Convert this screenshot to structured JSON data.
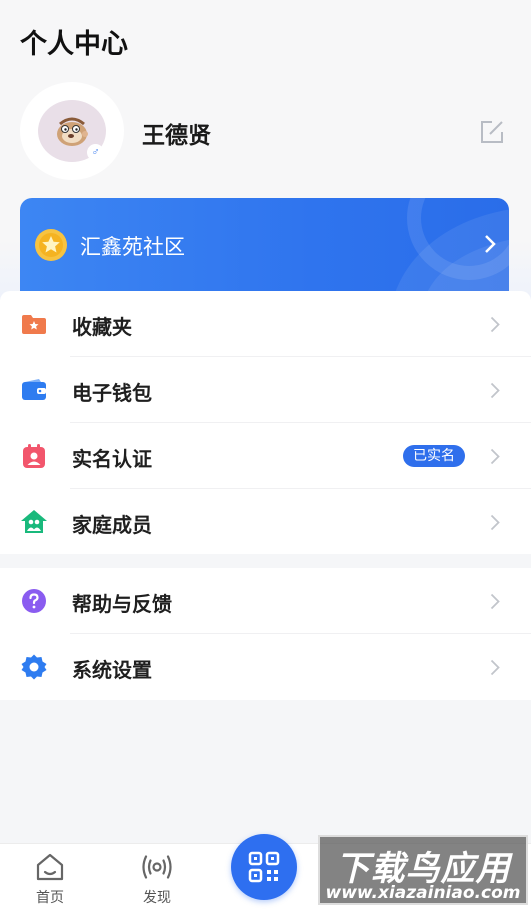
{
  "header": {
    "title": "个人中心"
  },
  "profile": {
    "name": "王德贤",
    "gender_icon": "male-icon",
    "gender_symbol": "♂"
  },
  "community": {
    "name": "汇鑫苑社区"
  },
  "menu_group_1": [
    {
      "label": "收藏夹",
      "icon": "favorites-folder-icon"
    },
    {
      "label": "电子钱包",
      "icon": "wallet-icon"
    },
    {
      "label": "实名认证",
      "icon": "id-card-icon",
      "badge": "已实名"
    },
    {
      "label": "家庭成员",
      "icon": "family-home-icon"
    }
  ],
  "menu_group_2": [
    {
      "label": "帮助与反馈",
      "icon": "help-icon"
    },
    {
      "label": "系统设置",
      "icon": "settings-gear-icon"
    }
  ],
  "bottom_nav": [
    {
      "label": "首页",
      "icon": "home-icon"
    },
    {
      "label": "发现",
      "icon": "discover-signal-icon"
    }
  ],
  "watermark": {
    "title": "下载鸟应用",
    "url": "www.xiazainiao.com"
  },
  "colors": {
    "accent": "#2e6ff0",
    "banner_start": "#3d86f3",
    "banner_end": "#2a6de9",
    "page_bg": "#f5f6f8"
  }
}
